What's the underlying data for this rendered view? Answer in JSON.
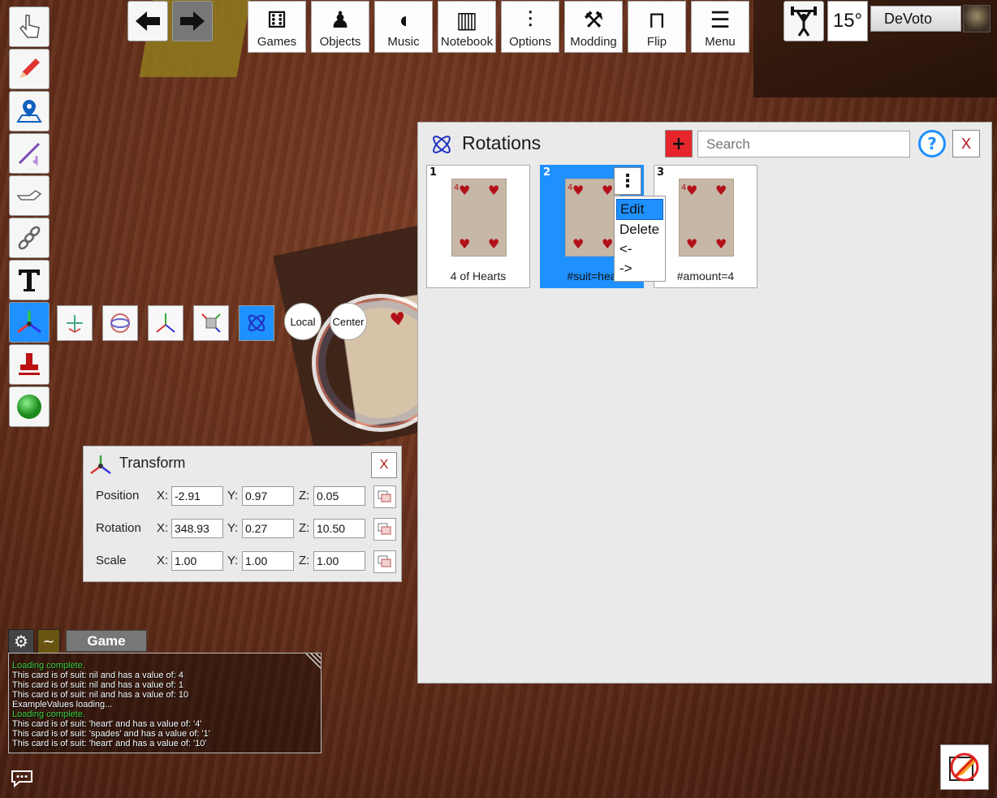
{
  "nav": {
    "back_icon": "arrow-left-icon",
    "forward_icon": "arrow-right-icon"
  },
  "topbar": [
    {
      "label": "Games",
      "icon": "dice-icon"
    },
    {
      "label": "Objects",
      "icon": "pawn-icon"
    },
    {
      "label": "Music",
      "icon": "speaker-icon"
    },
    {
      "label": "Notebook",
      "icon": "notebook-icon"
    },
    {
      "label": "Options",
      "icon": "sliders-icon"
    },
    {
      "label": "Modding",
      "icon": "tools-icon"
    },
    {
      "label": "Flip",
      "icon": "flip-table-icon"
    },
    {
      "label": "Menu",
      "icon": "hamburger-icon"
    }
  ],
  "user": {
    "rotation_step": "15°",
    "name": "DeVoto"
  },
  "gizmo": {
    "local_label": "Local",
    "center_label": "Center"
  },
  "rotations_panel": {
    "title": "Rotations",
    "search_placeholder": "Search",
    "add_label": "+",
    "help_label": "?",
    "close_label": "X",
    "kebab_label": "⋮",
    "tiles": [
      {
        "index": "1",
        "label": "4 of Hearts",
        "selected": false
      },
      {
        "index": "2",
        "label": "#suit=hea",
        "selected": true
      },
      {
        "index": "3",
        "label": "#amount=4",
        "selected": false
      }
    ],
    "context_menu": [
      "Edit",
      "Delete",
      "<-",
      "->"
    ]
  },
  "transform_panel": {
    "title": "Transform",
    "close_label": "X",
    "axis_labels": [
      "X:",
      "Y:",
      "Z:"
    ],
    "rows": [
      {
        "label": "Position",
        "x": "-2.91",
        "y": "0.97",
        "z": "0.05"
      },
      {
        "label": "Rotation",
        "x": "348.93",
        "y": "0.27",
        "z": "10.50"
      },
      {
        "label": "Scale",
        "x": "1.00",
        "y": "1.00",
        "z": "1.00"
      }
    ]
  },
  "chat": {
    "gear_label": "⚙",
    "tilde_label": "~",
    "tab_label": "Game",
    "log": [
      {
        "text": "Loading complete.",
        "color": "#3fd13f"
      },
      {
        "text": "This card is of suit: nil and has a value of: 4",
        "color": "#ffffff"
      },
      {
        "text": "This card is of suit: nil and has a value of: 1",
        "color": "#ffffff"
      },
      {
        "text": "This card is of suit: nil and has a value of: 10",
        "color": "#ffffff"
      },
      {
        "text": "ExampleValues loading...",
        "color": "#ffffff"
      },
      {
        "text": "Loading complete.",
        "color": "#3fd13f"
      },
      {
        "text": "This card is of suit: 'heart' and has a value of: '4'",
        "color": "#ffffff"
      },
      {
        "text": "This card is of suit: 'spades' and has a value of: '1'",
        "color": "#ffffff"
      },
      {
        "text": "This card is of suit: 'heart' and has a value of: '10'",
        "color": "#ffffff"
      }
    ]
  },
  "colors": {
    "accent": "#1e90ff",
    "danger": "#e7262c",
    "chat_green": "#3fd13f"
  }
}
